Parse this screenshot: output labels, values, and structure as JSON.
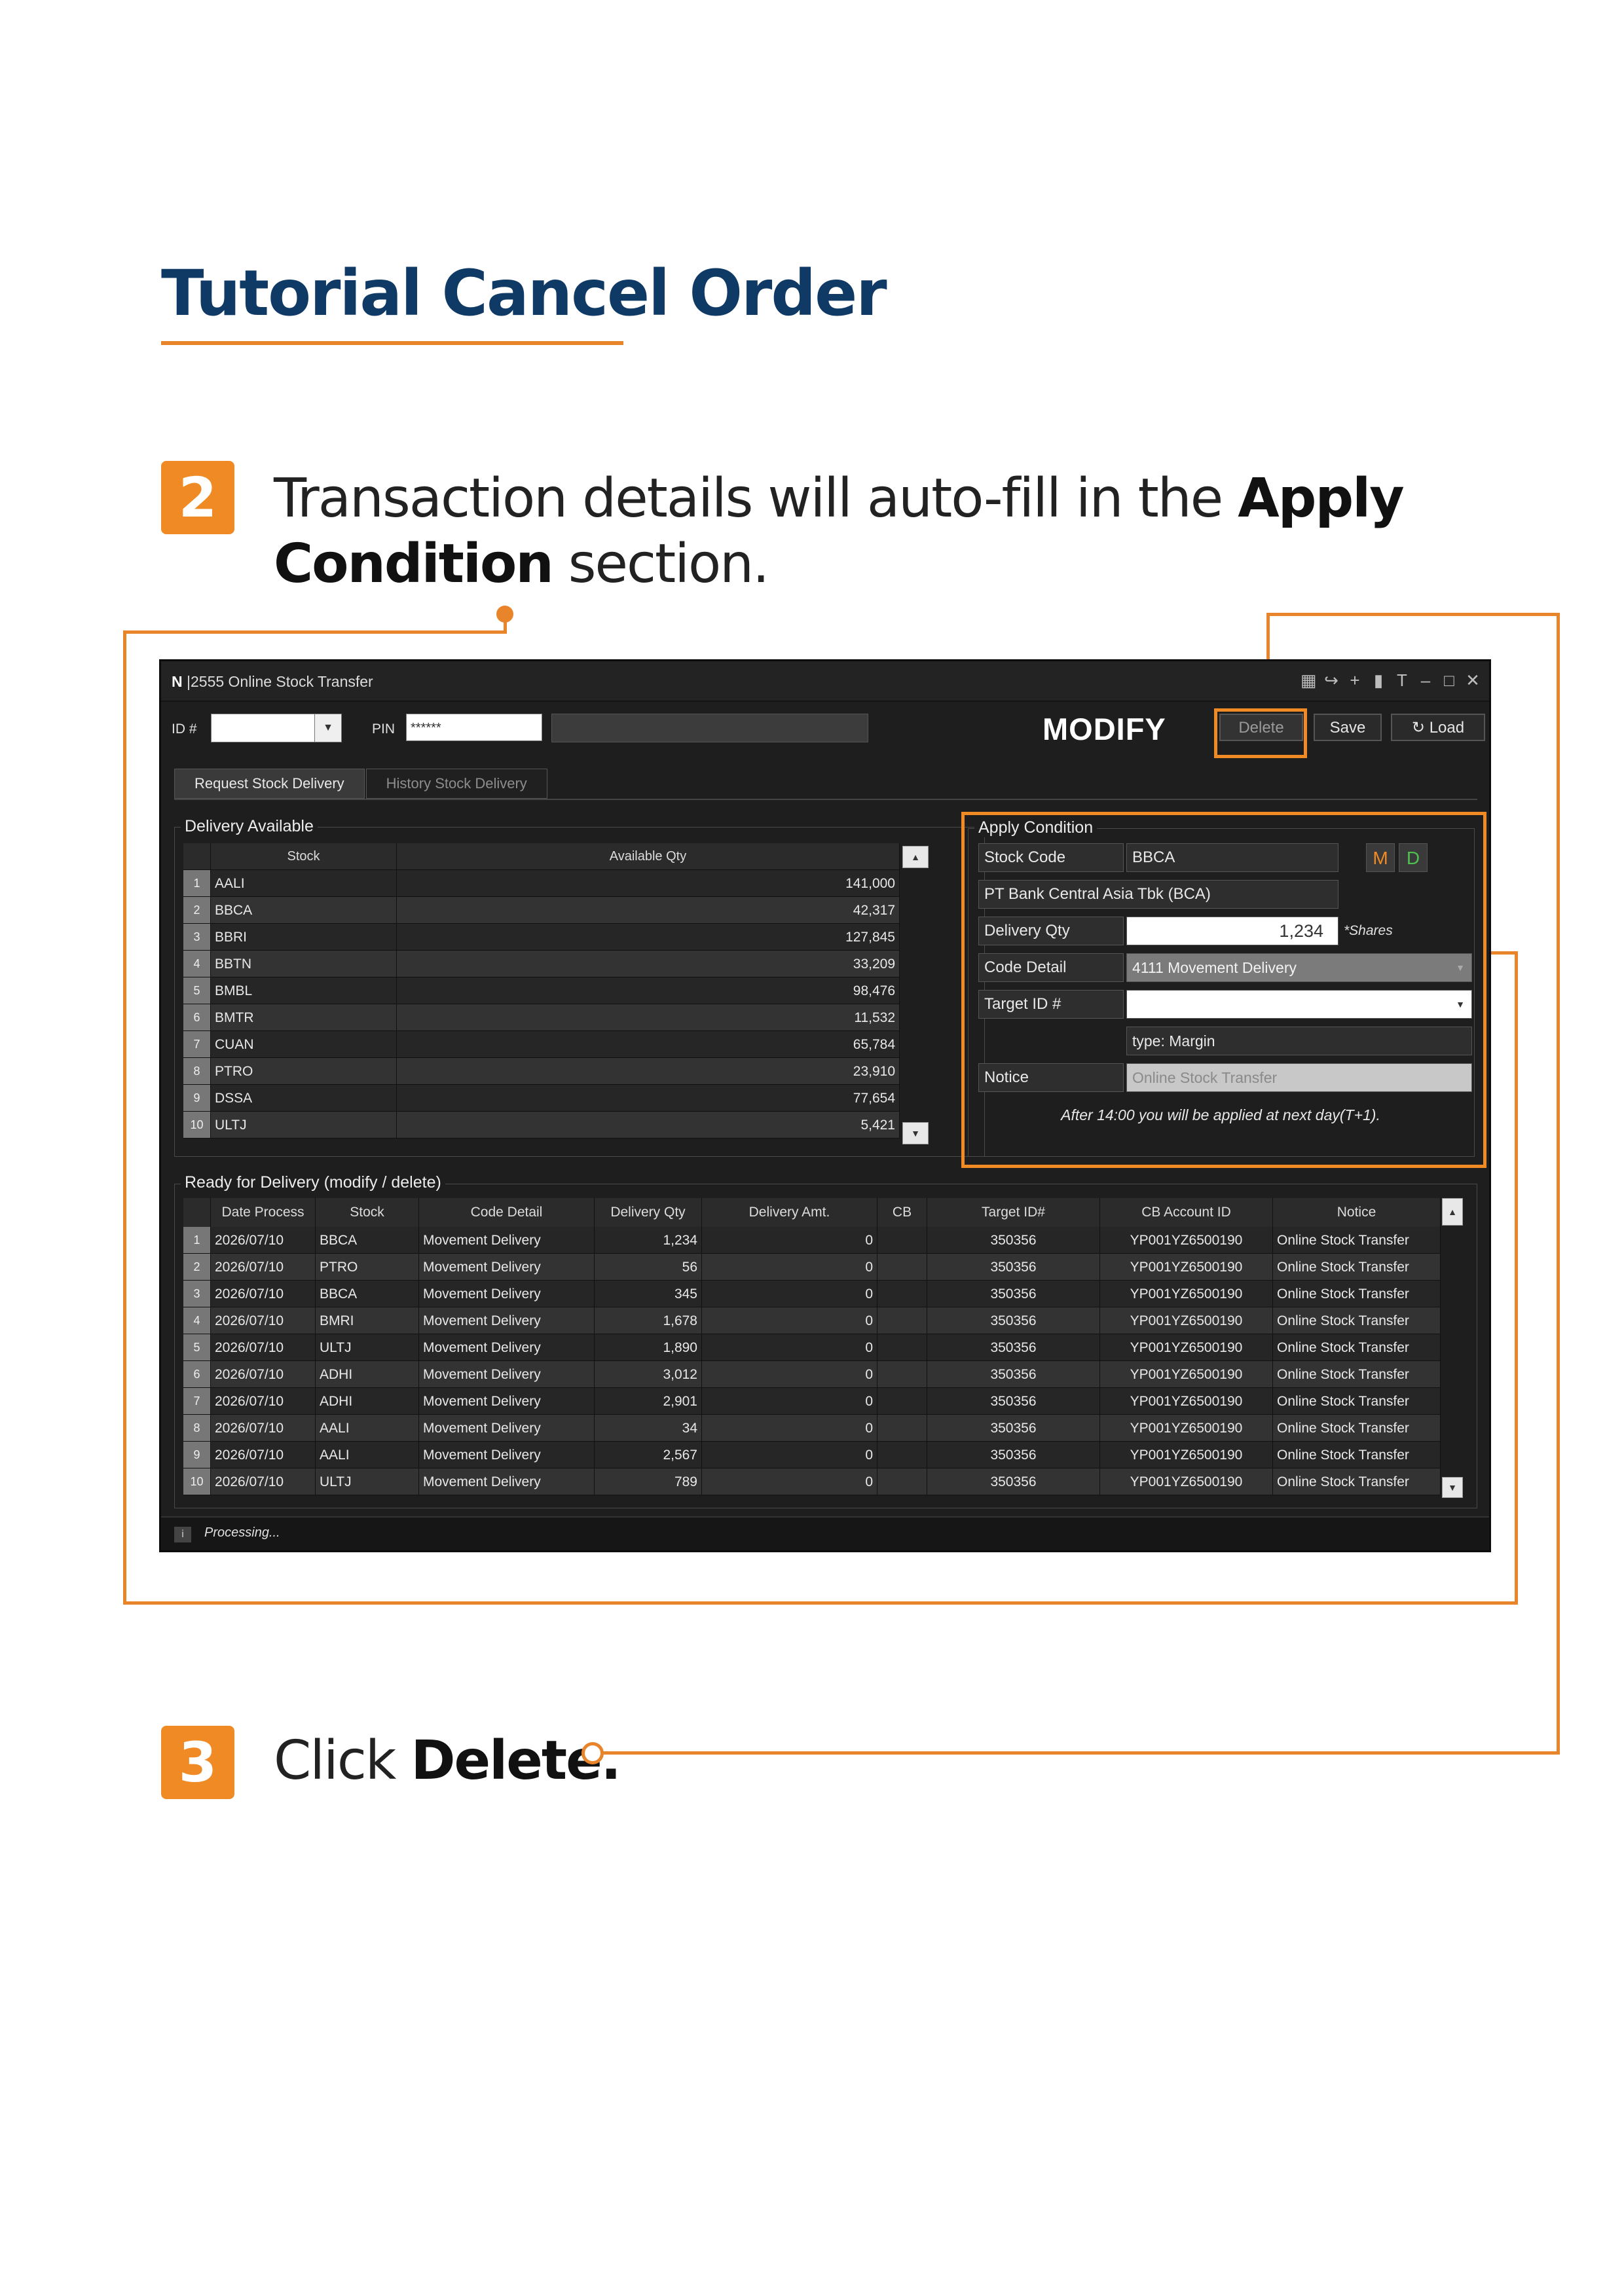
{
  "page": {
    "title": "Tutorial Cancel Order",
    "step2": {
      "number": "2",
      "text_a": "Transaction details will auto-fill in the ",
      "bold_a": "Apply",
      "bold_b": "Condition",
      "text_b": " section."
    },
    "step3": {
      "number": "3",
      "text": "Click ",
      "bold": "Delete."
    },
    "accent_color": "#f08a24",
    "title_color": "#0f3a66"
  },
  "app": {
    "logo": "N",
    "window_title": "|2555 Online Stock Transfer",
    "window_controls": [
      "grid-icon",
      "export-icon",
      "plus-icon",
      "trash-icon",
      "font-size-icon",
      "minimize-icon",
      "maximize-icon",
      "close-icon"
    ],
    "toolbar": {
      "id_label": "ID #",
      "id_value": "",
      "pin_label": "PIN",
      "pin_value": "******",
      "mode": "MODIFY",
      "delete_label": "Delete",
      "save_label": "Save",
      "load_label": "Load"
    },
    "tabs": [
      {
        "label": "Request Stock Delivery",
        "active": true
      },
      {
        "label": "History Stock Delivery",
        "active": false
      }
    ],
    "delivery_available": {
      "title": "Delivery Available",
      "headers": [
        "Stock",
        "Available Qty"
      ],
      "rows": [
        {
          "n": "1",
          "stock": "AALI",
          "qty": "141,000"
        },
        {
          "n": "2",
          "stock": "BBCA",
          "qty": "42,317"
        },
        {
          "n": "3",
          "stock": "BBRI",
          "qty": "127,845"
        },
        {
          "n": "4",
          "stock": "BBTN",
          "qty": "33,209"
        },
        {
          "n": "5",
          "stock": "BMBL",
          "qty": "98,476"
        },
        {
          "n": "6",
          "stock": "BMTR",
          "qty": "11,532"
        },
        {
          "n": "7",
          "stock": "CUAN",
          "qty": "65,784"
        },
        {
          "n": "8",
          "stock": "PTRO",
          "qty": "23,910"
        },
        {
          "n": "9",
          "stock": "DSSA",
          "qty": "77,654"
        },
        {
          "n": "10",
          "stock": "ULTJ",
          "qty": "5,421"
        }
      ]
    },
    "apply_condition": {
      "title": "Apply Condition",
      "stock_code_label": "Stock Code",
      "stock_code": "BBCA",
      "m_label": "M",
      "d_label": "D",
      "company_name": "PT Bank Central Asia Tbk (BCA)",
      "delivery_qty_label": "Delivery Qty",
      "delivery_qty": "1,234",
      "shares_note": "*Shares",
      "code_detail_label": "Code Detail",
      "code_detail": "4111 Movement Delivery",
      "target_id_label": "Target ID #",
      "target_id": "",
      "type": "type: Margin",
      "notice_label": "Notice",
      "notice_placeholder": "Online Stock Transfer",
      "footnote": "After 14:00 you will be applied at next day(T+1)."
    },
    "ready": {
      "title": "Ready for Delivery (modify / delete)",
      "headers": [
        "Date Process",
        "Stock",
        "Code Detail",
        "Delivery Qty",
        "Delivery Amt.",
        "CB",
        "Target ID#",
        "CB Account ID",
        "Notice"
      ],
      "rows": [
        {
          "n": "1",
          "date": "2026/07/10",
          "stock": "BBCA",
          "code": "Movement Delivery",
          "qty": "1,234",
          "amt": "0",
          "cb": "",
          "target": "350356",
          "account": "YP001YZ6500190",
          "notice": "Online Stock Transfer"
        },
        {
          "n": "2",
          "date": "2026/07/10",
          "stock": "PTRO",
          "code": "Movement Delivery",
          "qty": "56",
          "amt": "0",
          "cb": "",
          "target": "350356",
          "account": "YP001YZ6500190",
          "notice": "Online Stock Transfer"
        },
        {
          "n": "3",
          "date": "2026/07/10",
          "stock": "BBCA",
          "code": "Movement Delivery",
          "qty": "345",
          "amt": "0",
          "cb": "",
          "target": "350356",
          "account": "YP001YZ6500190",
          "notice": "Online Stock Transfer"
        },
        {
          "n": "4",
          "date": "2026/07/10",
          "stock": "BMRI",
          "code": "Movement Delivery",
          "qty": "1,678",
          "amt": "0",
          "cb": "",
          "target": "350356",
          "account": "YP001YZ6500190",
          "notice": "Online Stock Transfer"
        },
        {
          "n": "5",
          "date": "2026/07/10",
          "stock": "ULTJ",
          "code": "Movement Delivery",
          "qty": "1,890",
          "amt": "0",
          "cb": "",
          "target": "350356",
          "account": "YP001YZ6500190",
          "notice": "Online Stock Transfer"
        },
        {
          "n": "6",
          "date": "2026/07/10",
          "stock": "ADHI",
          "code": "Movement Delivery",
          "qty": "3,012",
          "amt": "0",
          "cb": "",
          "target": "350356",
          "account": "YP001YZ6500190",
          "notice": "Online Stock Transfer"
        },
        {
          "n": "7",
          "date": "2026/07/10",
          "stock": "ADHI",
          "code": "Movement Delivery",
          "qty": "2,901",
          "amt": "0",
          "cb": "",
          "target": "350356",
          "account": "YP001YZ6500190",
          "notice": "Online Stock Transfer"
        },
        {
          "n": "8",
          "date": "2026/07/10",
          "stock": "AALI",
          "code": "Movement Delivery",
          "qty": "34",
          "amt": "0",
          "cb": "",
          "target": "350356",
          "account": "YP001YZ6500190",
          "notice": "Online Stock Transfer"
        },
        {
          "n": "9",
          "date": "2026/07/10",
          "stock": "AALI",
          "code": "Movement Delivery",
          "qty": "2,567",
          "amt": "0",
          "cb": "",
          "target": "350356",
          "account": "YP001YZ6500190",
          "notice": "Online Stock Transfer"
        },
        {
          "n": "10",
          "date": "2026/07/10",
          "stock": "ULTJ",
          "code": "Movement Delivery",
          "qty": "789",
          "amt": "0",
          "cb": "",
          "target": "350356",
          "account": "YP001YZ6500190",
          "notice": "Online Stock Transfer"
        }
      ]
    },
    "status": "Processing..."
  }
}
